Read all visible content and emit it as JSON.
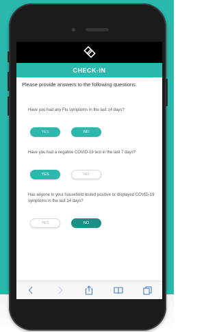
{
  "header": {
    "title": "CHECK-IN"
  },
  "intro": "Please provide answers to the following questions.",
  "questions": [
    {
      "text": "Have you had any Flu symptoms in the last 14 days?",
      "yes": "YES",
      "no": "NO",
      "selected": "no"
    },
    {
      "text": "Have you had a negative COVID-19 test in the last 7 days?",
      "yes": "YES",
      "no": "NO",
      "selected": "yes"
    },
    {
      "text": "Has anyone in your household tested positive or displayed COVID-19 symptoms in the last 14 days?",
      "yes": "YES",
      "no": "NO",
      "selected": "no"
    }
  ],
  "colors": {
    "accent": "#2bb8ad",
    "accent_dark": "#1f8f86",
    "logo_bar": "#000000"
  },
  "toolbar": {
    "icons": [
      "back-arrow-icon",
      "forward-arrow-icon",
      "share-icon",
      "bookmarks-icon",
      "tabs-icon"
    ]
  }
}
